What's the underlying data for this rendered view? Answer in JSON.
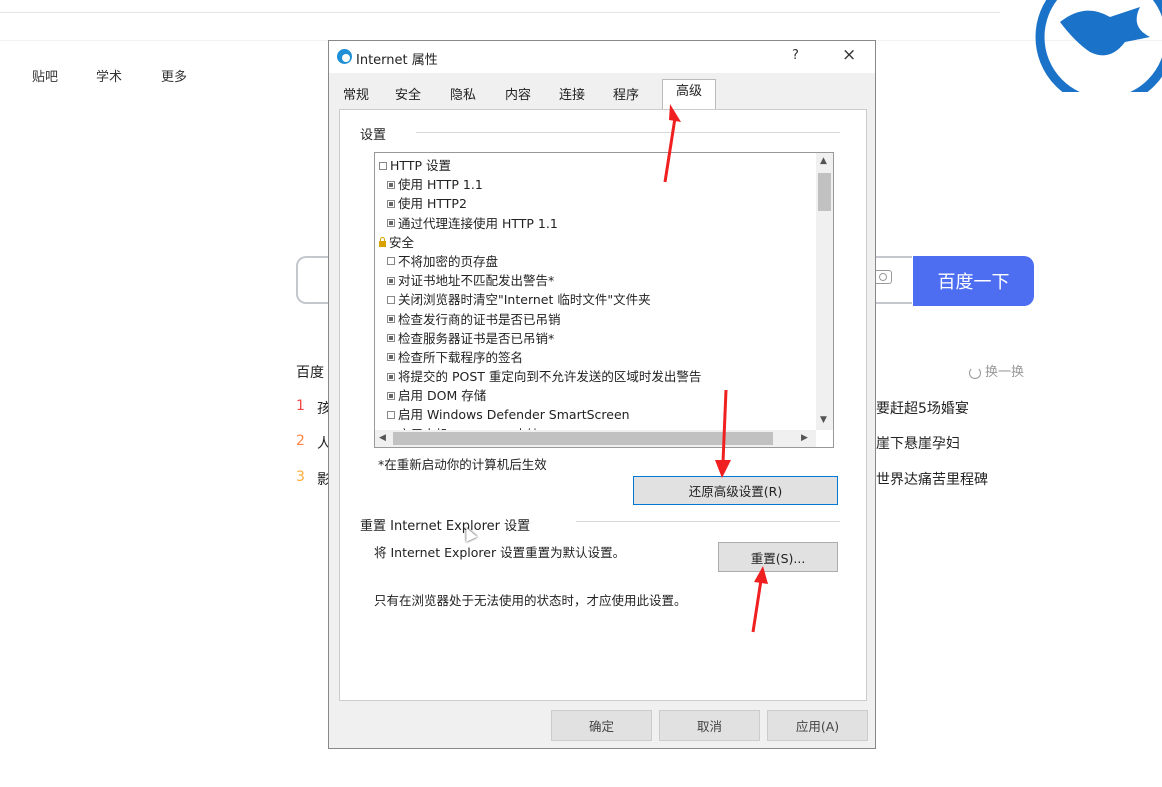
{
  "nav": [
    "贴吧",
    "学术",
    "更多"
  ],
  "search": {
    "button_label": "百度一下"
  },
  "hot": {
    "title_fragment": "百度",
    "refresh_label": "换一换",
    "items": [
      {
        "num": "1",
        "start": "孩",
        "end": "要赶超5场婚宴",
        "color": "#f54545"
      },
      {
        "num": "2",
        "start": "人",
        "end": "崖下悬崖孕妇",
        "color": "#ff8547"
      },
      {
        "num": "3",
        "start": "影",
        "end": "世界达痛苦里程碑",
        "color": "#ffac38"
      }
    ]
  },
  "dialog": {
    "title": "Internet 属性",
    "help": "?",
    "close": "×",
    "tabs": [
      "常规",
      "安全",
      "隐私",
      "内容",
      "连接",
      "程序",
      "高级"
    ],
    "active_tab": "高级",
    "settings_label": "设置",
    "settings_items": [
      {
        "type": "header-box",
        "label": "HTTP 设置"
      },
      {
        "type": "check",
        "checked": true,
        "label": "使用 HTTP 1.1"
      },
      {
        "type": "check",
        "checked": true,
        "label": "使用 HTTP2"
      },
      {
        "type": "check",
        "checked": true,
        "label": "通过代理连接使用 HTTP 1.1"
      },
      {
        "type": "header-lock",
        "label": "安全"
      },
      {
        "type": "check",
        "checked": false,
        "label": "不将加密的页存盘"
      },
      {
        "type": "check",
        "checked": true,
        "label": "对证书地址不匹配发出警告*"
      },
      {
        "type": "check",
        "checked": false,
        "label": "关闭浏览器时清空\"Internet 临时文件\"文件夹"
      },
      {
        "type": "check",
        "checked": true,
        "label": "检查发行商的证书是否已吊销"
      },
      {
        "type": "check",
        "checked": true,
        "label": "检查服务器证书是否已吊销*"
      },
      {
        "type": "check",
        "checked": true,
        "label": "检查所下载程序的签名"
      },
      {
        "type": "check",
        "checked": true,
        "label": "将提交的 POST 重定向到不允许发送的区域时发出警告"
      },
      {
        "type": "check",
        "checked": true,
        "label": "启用 DOM 存储"
      },
      {
        "type": "check",
        "checked": false,
        "label": "启用 Windows Defender SmartScreen"
      },
      {
        "type": "check",
        "checked": true,
        "label": "启用本机 XMLHTTP 支持"
      }
    ],
    "restart_note": "*在重新启动你的计算机后生效",
    "restore_button": "还原高级设置(R)",
    "reset_group_label": "重置 Internet Explorer 设置",
    "reset_desc": "将 Internet Explorer 设置重置为默认设置。",
    "reset_button": "重置(S)...",
    "reset_warning": "只有在浏览器处于无法使用的状态时，才应使用此设置。",
    "ok_button": "确定",
    "cancel_button": "取消",
    "apply_button": "应用(A)"
  }
}
